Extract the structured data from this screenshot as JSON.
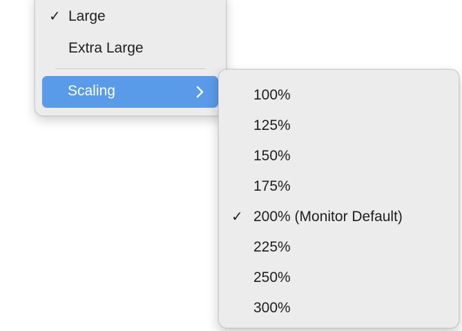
{
  "main_menu": {
    "items": [
      {
        "label": "Large",
        "checked": true
      },
      {
        "label": "Extra Large",
        "checked": false
      }
    ],
    "scaling": {
      "label": "Scaling",
      "highlight_color": "#5a9be9",
      "icon": "chevron-right-icon"
    }
  },
  "checkmark": "✓",
  "submenu": {
    "items": [
      {
        "label": "100%",
        "checked": false
      },
      {
        "label": "125%",
        "checked": false
      },
      {
        "label": "150%",
        "checked": false
      },
      {
        "label": "175%",
        "checked": false
      },
      {
        "label": "200% (Monitor Default)",
        "checked": true
      },
      {
        "label": "225%",
        "checked": false
      },
      {
        "label": "250%",
        "checked": false
      },
      {
        "label": "300%",
        "checked": false
      }
    ]
  }
}
